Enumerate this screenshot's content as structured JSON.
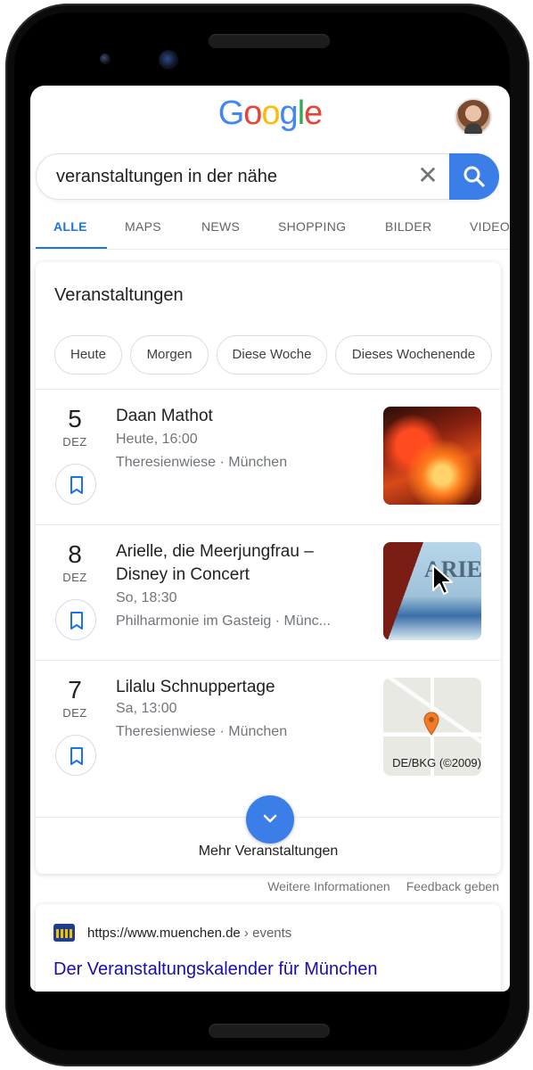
{
  "header": {
    "logo_letters": [
      {
        "char": "G",
        "color": "#4285F4"
      },
      {
        "char": "o",
        "color": "#EA4335"
      },
      {
        "char": "o",
        "color": "#FBBC05"
      },
      {
        "char": "g",
        "color": "#4285F4"
      },
      {
        "char": "l",
        "color": "#34A853"
      },
      {
        "char": "e",
        "color": "#EA4335"
      }
    ],
    "avatar_icon": "user-avatar"
  },
  "search": {
    "query": "veranstaltungen in der nähe",
    "clear_icon": "close-icon",
    "search_icon": "search-icon",
    "accent": "#3C7EE8"
  },
  "tabs": [
    {
      "label": "ALLE",
      "active": true
    },
    {
      "label": "MAPS",
      "active": false
    },
    {
      "label": "NEWS",
      "active": false
    },
    {
      "label": "SHOPPING",
      "active": false
    },
    {
      "label": "BILDER",
      "active": false
    },
    {
      "label": "VIDEOS",
      "active": false
    }
  ],
  "events_card": {
    "title": "Veranstaltungen",
    "chips": [
      "Heute",
      "Morgen",
      "Diese Woche",
      "Dieses Wochenende"
    ],
    "events": [
      {
        "day": "5",
        "month": "DEZ",
        "title": "Daan Mathot",
        "time": "Heute, 16:00",
        "venue": "Theresienwiese · München"
      },
      {
        "day": "8",
        "month": "DEZ",
        "title": "Arielle, die Meerjungfrau – Disney in Concert",
        "time": "So, 18:30",
        "venue": "Philharmonie im Gasteig · Münc...",
        "thumb_text": "ARIE"
      },
      {
        "day": "7",
        "month": "DEZ",
        "title": "Lilalu Schnuppertage",
        "time": "Sa, 13:00",
        "venue": "Theresienwiese · München",
        "map_credit": "DE/BKG (©2009)"
      }
    ],
    "more_label": "Mehr Veranstaltungen",
    "more_icon": "chevron-down-icon"
  },
  "footer_links": [
    "Weitere Informationen",
    "Feedback geben"
  ],
  "result": {
    "url": "https://www.muenchen.de",
    "path": " › events",
    "title": "Der Veranstaltungskalender für München"
  }
}
